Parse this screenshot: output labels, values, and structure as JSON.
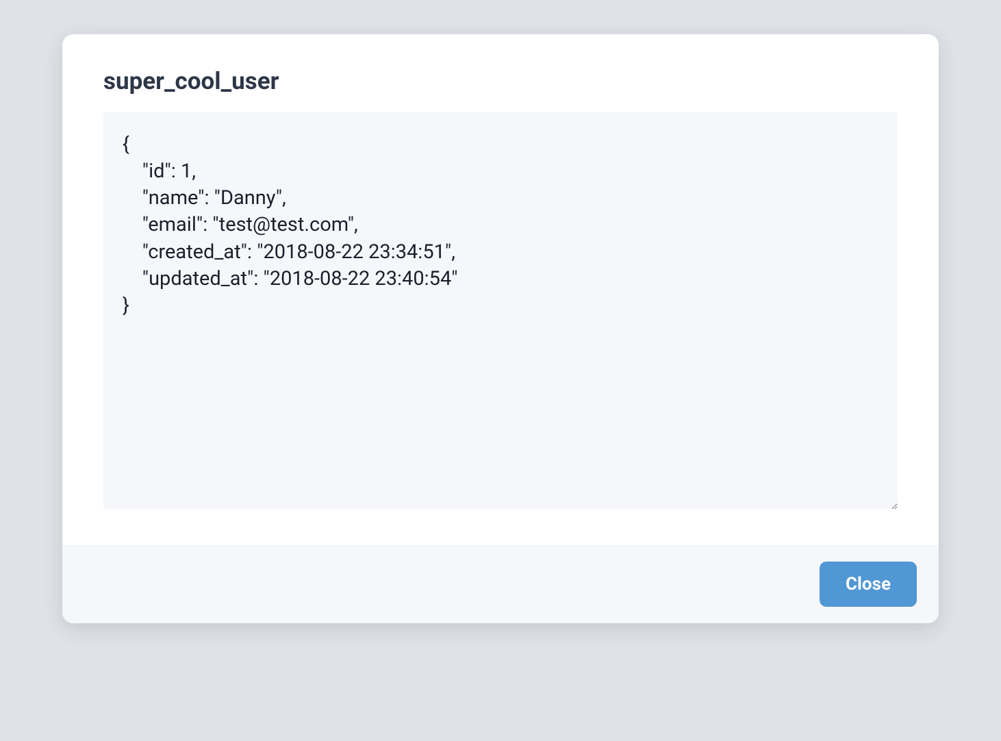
{
  "modal": {
    "title": "super_cool_user",
    "body": "{\n    \"id\": 1,\n    \"name\": \"Danny\",\n    \"email\": \"test@test.com\",\n    \"created_at\": \"2018-08-22 23:34:51\",\n    \"updated_at\": \"2018-08-22 23:40:54\"\n}",
    "close_label": "Close"
  }
}
